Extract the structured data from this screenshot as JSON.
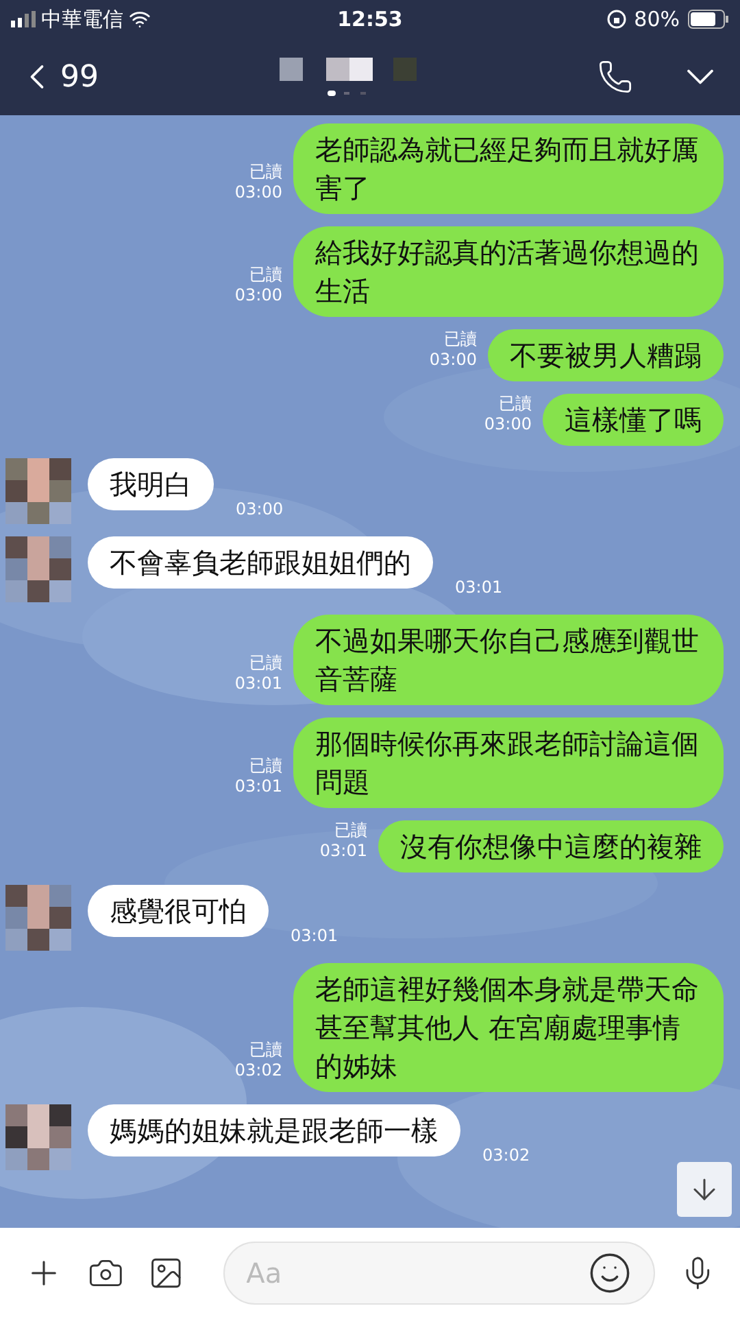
{
  "status_bar": {
    "carrier": "中華電信",
    "time": "12:53",
    "battery": "80%"
  },
  "header": {
    "back_count": "99"
  },
  "messages": [
    {
      "kind": "sent",
      "text": "老師認為就已經足夠而且就好厲害了",
      "read": "已讀",
      "time": "03:00"
    },
    {
      "kind": "sent",
      "text": "給我好好認真的活著過你想過的生活",
      "read": "已讀",
      "time": "03:00"
    },
    {
      "kind": "sent",
      "text": "不要被男人糟蹋",
      "read": "已讀",
      "time": "03:00"
    },
    {
      "kind": "sent",
      "text": "這樣懂了嗎",
      "read": "已讀",
      "time": "03:00"
    },
    {
      "kind": "received",
      "text": "我明白",
      "time": "03:00"
    },
    {
      "kind": "received",
      "text": "不會辜負老師跟姐姐們的",
      "time": "03:01"
    },
    {
      "kind": "sent",
      "text": "不過如果哪天你自己感應到觀世音菩薩",
      "read": "已讀",
      "time": "03:01"
    },
    {
      "kind": "sent",
      "text": "那個時候你再來跟老師討論這個問題",
      "read": "已讀",
      "time": "03:01"
    },
    {
      "kind": "sent",
      "text": "沒有你想像中這麼的複雜",
      "read": "已讀",
      "time": "03:01"
    },
    {
      "kind": "received",
      "text": "感覺很可怕",
      "time": "03:01"
    },
    {
      "kind": "sent",
      "text": "老師這裡好幾個本身就是帶天命甚至幫其他人 在宮廟處理事情的姊妹",
      "read": "已讀",
      "time": "03:02"
    },
    {
      "kind": "received",
      "text": "媽媽的姐妹就是跟老師一樣",
      "time": "03:02"
    }
  ],
  "input": {
    "placeholder": "Aa"
  }
}
